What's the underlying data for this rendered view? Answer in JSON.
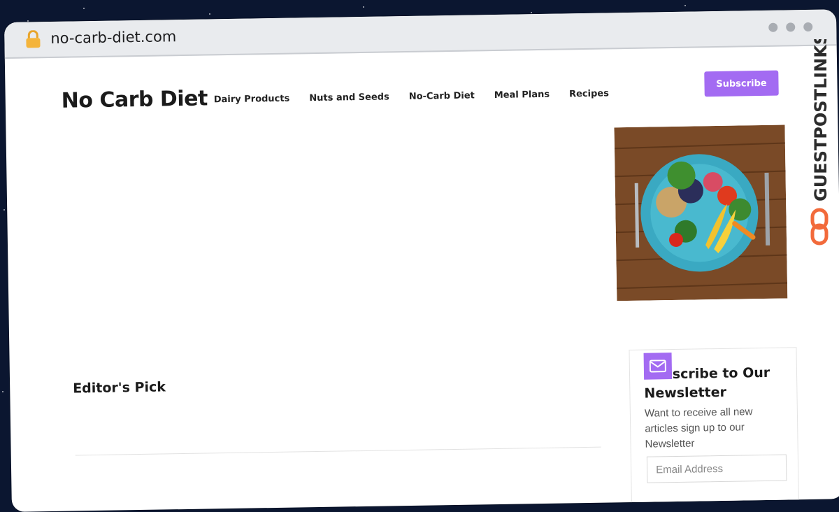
{
  "browser": {
    "url": "no-carb-diet.com"
  },
  "site": {
    "logo": "No Carb Diet",
    "nav": [
      "Dairy Products",
      "Nuts and Seeds",
      "No-Carb Diet",
      "Meal Plans",
      "Recipes"
    ],
    "subscribe_label": "Subscribe"
  },
  "main": {
    "editors_pick": "Editor's Pick"
  },
  "newsletter": {
    "title": "Subscribe to Our Newsletter",
    "text": "Want to receive all new articles sign up to our Newsletter",
    "email_placeholder": "Email Address"
  },
  "watermark": {
    "text": "GUESTPOSTLINKS"
  },
  "colors": {
    "accent": "#a36bf2",
    "watermark_orange": "#f26a3b"
  }
}
